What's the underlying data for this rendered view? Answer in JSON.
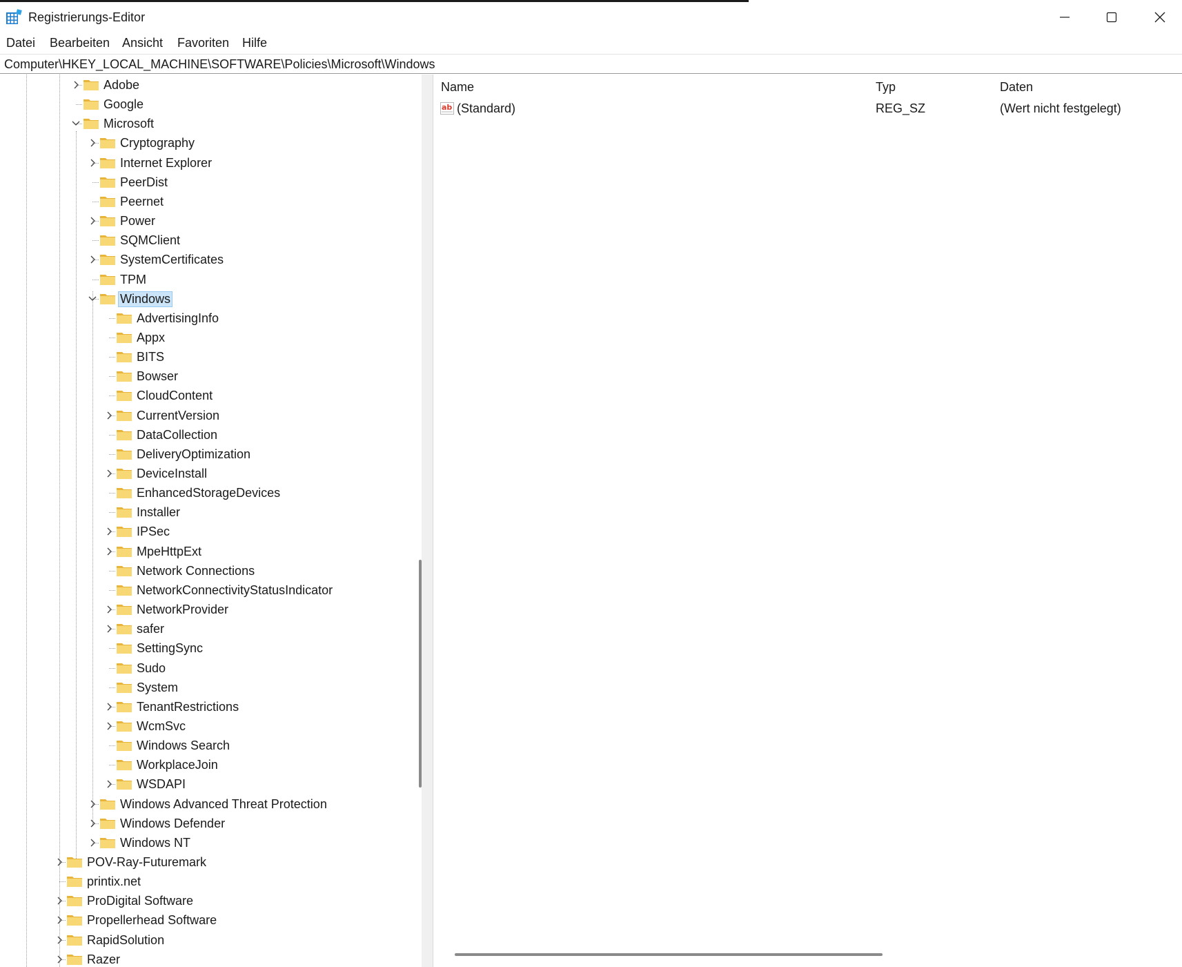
{
  "window": {
    "title": "Registrierungs-Editor",
    "controls": {
      "minimize": "minimize",
      "maximize": "maximize",
      "close": "close"
    }
  },
  "menu": [
    "Datei",
    "Bearbeiten",
    "Ansicht",
    "Favoriten",
    "Hilfe"
  ],
  "address": "Computer\\HKEY_LOCAL_MACHINE\\SOFTWARE\\Policies\\Microsoft\\Windows",
  "tree": [
    {
      "label": "Adobe",
      "level": 0,
      "expander": "collapsed"
    },
    {
      "label": "Google",
      "level": 0,
      "expander": "none"
    },
    {
      "label": "Microsoft",
      "level": 0,
      "expander": "expanded"
    },
    {
      "label": "Cryptography",
      "level": 1,
      "expander": "collapsed"
    },
    {
      "label": "Internet Explorer",
      "level": 1,
      "expander": "collapsed"
    },
    {
      "label": "PeerDist",
      "level": 1,
      "expander": "none"
    },
    {
      "label": "Peernet",
      "level": 1,
      "expander": "none"
    },
    {
      "label": "Power",
      "level": 1,
      "expander": "collapsed"
    },
    {
      "label": "SQMClient",
      "level": 1,
      "expander": "none"
    },
    {
      "label": "SystemCertificates",
      "level": 1,
      "expander": "collapsed"
    },
    {
      "label": "TPM",
      "level": 1,
      "expander": "none"
    },
    {
      "label": "Windows",
      "level": 1,
      "expander": "expanded",
      "selected": true
    },
    {
      "label": "AdvertisingInfo",
      "level": 2,
      "expander": "none"
    },
    {
      "label": "Appx",
      "level": 2,
      "expander": "none"
    },
    {
      "label": "BITS",
      "level": 2,
      "expander": "none"
    },
    {
      "label": "Bowser",
      "level": 2,
      "expander": "none"
    },
    {
      "label": "CloudContent",
      "level": 2,
      "expander": "none"
    },
    {
      "label": "CurrentVersion",
      "level": 2,
      "expander": "collapsed"
    },
    {
      "label": "DataCollection",
      "level": 2,
      "expander": "none"
    },
    {
      "label": "DeliveryOptimization",
      "level": 2,
      "expander": "none"
    },
    {
      "label": "DeviceInstall",
      "level": 2,
      "expander": "collapsed"
    },
    {
      "label": "EnhancedStorageDevices",
      "level": 2,
      "expander": "none"
    },
    {
      "label": "Installer",
      "level": 2,
      "expander": "none"
    },
    {
      "label": "IPSec",
      "level": 2,
      "expander": "collapsed"
    },
    {
      "label": "MpeHttpExt",
      "level": 2,
      "expander": "collapsed"
    },
    {
      "label": "Network Connections",
      "level": 2,
      "expander": "none"
    },
    {
      "label": "NetworkConnectivityStatusIndicator",
      "level": 2,
      "expander": "none"
    },
    {
      "label": "NetworkProvider",
      "level": 2,
      "expander": "collapsed"
    },
    {
      "label": "safer",
      "level": 2,
      "expander": "collapsed"
    },
    {
      "label": "SettingSync",
      "level": 2,
      "expander": "none"
    },
    {
      "label": "Sudo",
      "level": 2,
      "expander": "none"
    },
    {
      "label": "System",
      "level": 2,
      "expander": "none"
    },
    {
      "label": "TenantRestrictions",
      "level": 2,
      "expander": "collapsed"
    },
    {
      "label": "WcmSvc",
      "level": 2,
      "expander": "collapsed"
    },
    {
      "label": "Windows Search",
      "level": 2,
      "expander": "none"
    },
    {
      "label": "WorkplaceJoin",
      "level": 2,
      "expander": "none"
    },
    {
      "label": "WSDAPI",
      "level": 2,
      "expander": "collapsed"
    },
    {
      "label": "Windows Advanced Threat Protection",
      "level": 1,
      "expander": "collapsed"
    },
    {
      "label": "Windows Defender",
      "level": 1,
      "expander": "collapsed"
    },
    {
      "label": "Windows NT",
      "level": 1,
      "expander": "collapsed"
    },
    {
      "label": "POV-Ray-Futuremark",
      "level": -1,
      "expander": "collapsed"
    },
    {
      "label": "printix.net",
      "level": -1,
      "expander": "none"
    },
    {
      "label": "ProDigital Software",
      "level": -1,
      "expander": "collapsed"
    },
    {
      "label": "Propellerhead Software",
      "level": -1,
      "expander": "collapsed"
    },
    {
      "label": "RapidSolution",
      "level": -1,
      "expander": "collapsed"
    },
    {
      "label": "Razer",
      "level": -1,
      "expander": "collapsed"
    }
  ],
  "values": {
    "columns": {
      "name": "Name",
      "type": "Typ",
      "data": "Daten"
    },
    "rows": [
      {
        "name": "(Standard)",
        "type": "REG_SZ",
        "data": "(Wert nicht festgelegt)",
        "icon": "string-value-icon"
      }
    ]
  },
  "colors": {
    "selection_bg": "#cce4f7",
    "selection_border": "#99c9ef",
    "folder": "#f8d775",
    "folder_dark": "#e8b43a",
    "string_icon": "#d93a2b"
  }
}
